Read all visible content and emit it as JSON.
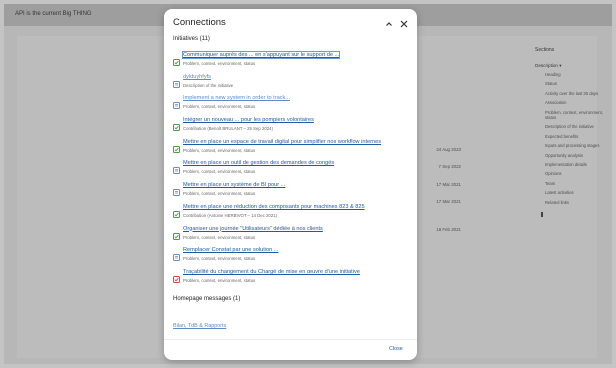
{
  "background": {
    "banner_text": "API is the current Big THING",
    "sections_title": "Sections",
    "description_label": "Description",
    "nav_items": [
      "Heading",
      "Status",
      "Activity over the last 30 days",
      "Association",
      "Problem, context, environment, status",
      "Description of the initiative",
      "Expected benefits",
      "Inputs and processing stages",
      "Opportunity analysis",
      "Implementation details",
      "Opinions",
      "Team",
      "Latest activities",
      "Related links"
    ],
    "dates": [
      "24 Aug 2023",
      "7 Sep 2022",
      "17 Mar 2021",
      "17 Mar 2021",
      "18 Feb 2021"
    ]
  },
  "modal": {
    "title": "Connections",
    "initiatives_header": "Initiatives (11)",
    "initiatives": [
      {
        "title": "Communiquer auprès des ... en s'appuyant sur le support de ...",
        "subtitle": "Problem, context, environment, status",
        "icon": "initiative-check-icon"
      },
      {
        "title": "dylduyhfyfs",
        "subtitle": "Description of the initiative",
        "icon": "initiative-doc-icon"
      },
      {
        "title": "Implement a new system in order to track...",
        "subtitle": "Problem, context, environment, status",
        "icon": "initiative-doc-icon"
      },
      {
        "title": "Intégrer un nouveau ... pour les pompiers volontaires",
        "subtitle": "Contribution (Benoît BRULANT – 25 Sep 2024)",
        "icon": "initiative-check-icon"
      },
      {
        "title": "Mettre en place un espace de travail digital pour simplifier nos workflow internes",
        "subtitle": "Problem, context, environment, status",
        "icon": "initiative-check-icon"
      },
      {
        "title": "Mettre en place un outil de gestion des demandes de congés",
        "subtitle": "Problem, context, environment, status",
        "icon": "initiative-doc-icon"
      },
      {
        "title": "Mettre en place un système de BI pour ...",
        "subtitle": "Problem, context, environment, status",
        "icon": "initiative-doc-icon"
      },
      {
        "title": "Mettre en place une réduction des composants pour machines 823 & 825",
        "subtitle": "Contribution (Antoine HERBIVOT – 14 Dec 2021)",
        "icon": "initiative-check-icon"
      },
      {
        "title": "Organiser une journée \"Utilisateurs\" dédiée à nos clients",
        "subtitle": "Problem, context, environment, status",
        "icon": "initiative-check-icon"
      },
      {
        "title": "Remplacer Constat par une solution ...",
        "subtitle": "Problem, context, environment, status",
        "icon": "initiative-doc-icon"
      },
      {
        "title": "Traçabilité du changement du Chargé de mise en œuvre d'une initiative",
        "subtitle": "Problem, context, environment, status",
        "icon": "initiative-alert-icon"
      }
    ],
    "homepage_header": "Homepage messages (1)",
    "homepage_link": "Bilan, TdB & Rapports",
    "close_label": "Close"
  }
}
